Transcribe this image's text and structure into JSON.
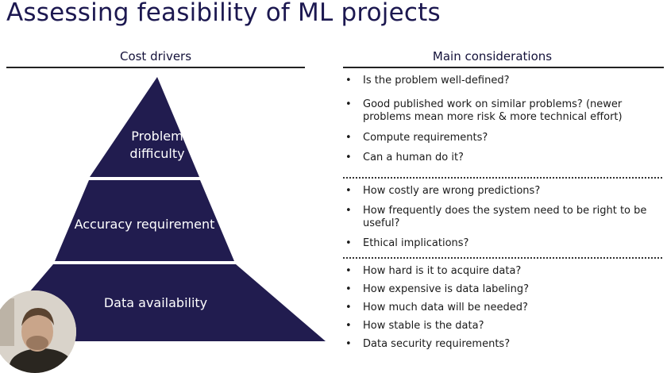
{
  "title": "Assessing feasibility of ML projects",
  "left_header": "Cost drivers",
  "right_header": "Main considerations",
  "pyramid": {
    "color": "#211c4f",
    "tiers": [
      {
        "label": "Problem\ndifficulty"
      },
      {
        "label": "Accuracy requirement"
      },
      {
        "label": "Data availability"
      }
    ]
  },
  "considerations": {
    "problem": [
      "Is the problem well-defined?",
      "Good published work on similar problems? (newer problems mean more risk & more technical effort)",
      "Compute requirements?",
      "Can a human do it?"
    ],
    "accuracy": [
      "How costly are wrong predictions?",
      "How frequently does the system need to be right to be useful?",
      "Ethical implications?"
    ],
    "data": [
      "How hard is it to acquire data?",
      "How expensive is data labeling?",
      "How much data will be needed?",
      "How stable is the data?",
      "Data security requirements?"
    ]
  }
}
